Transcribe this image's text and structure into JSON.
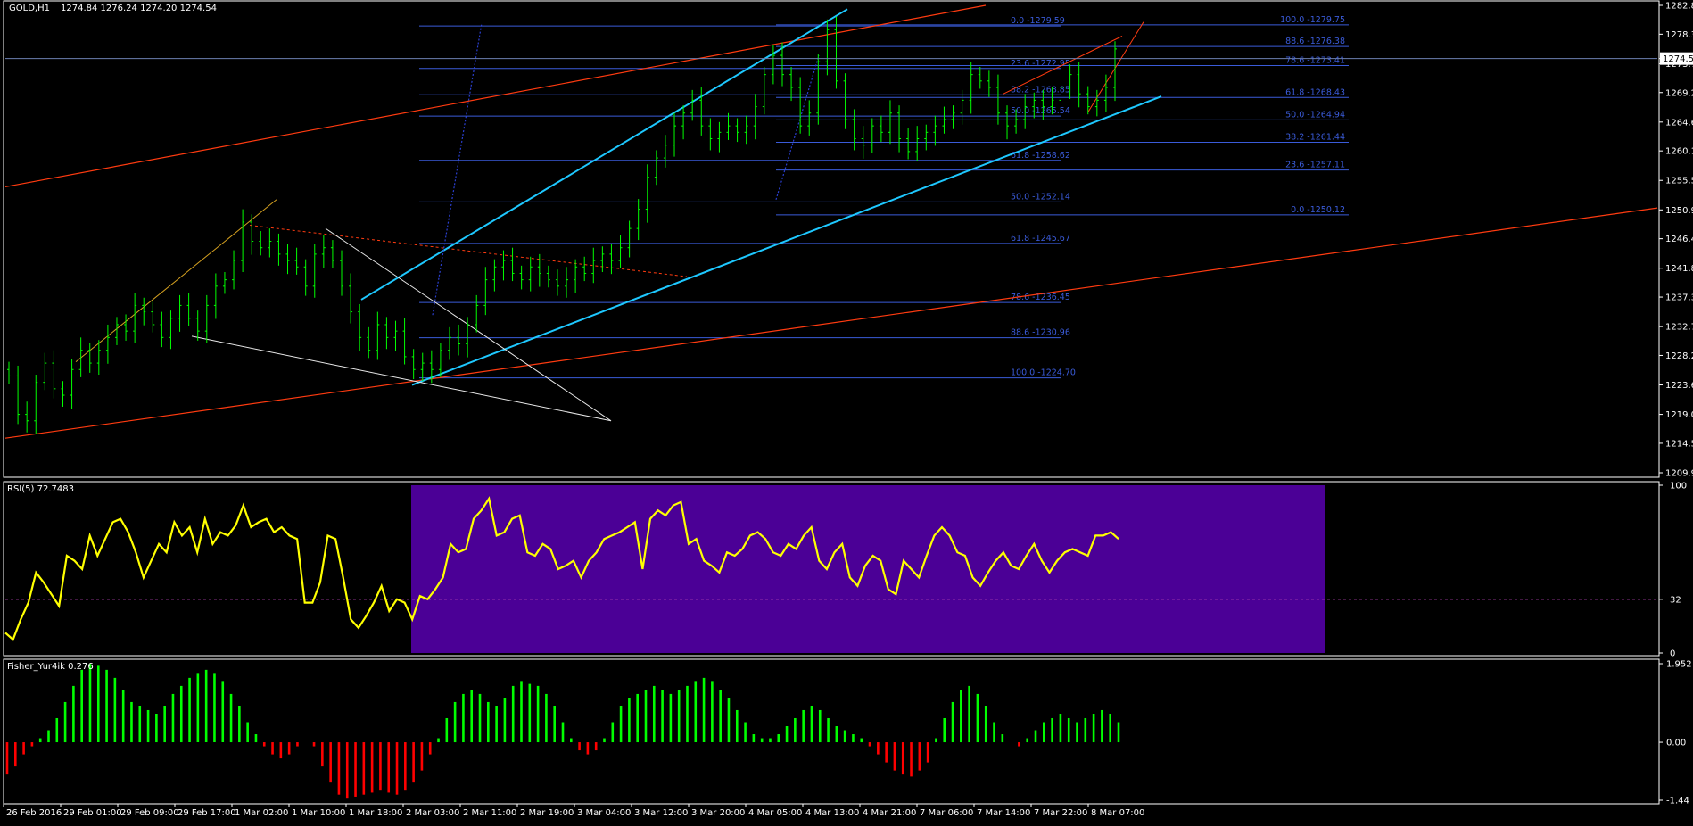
{
  "main_header": {
    "symbol": "GOLD,H1",
    "ohlc": "1274.84 1276.24 1274.20 1274.54"
  },
  "colors": {
    "background": "#000000",
    "candle": "#00ff00",
    "rsi_line": "#ffff00",
    "rsi_zone": "#4b0096",
    "fisher_positive": "#00ff00",
    "fisher_negative": "#ff0000",
    "trend_orange": "#ff3b10",
    "channel_cyan": "#1ec8ff",
    "fib_level": "#3a5bd9",
    "panel_border": "#ffffff"
  },
  "chart_data": [
    {
      "type": "candlestick",
      "title": "GOLD,H1",
      "ylim": [
        1209.9,
        1282.8
      ],
      "y_ticks": [
        "1282.8",
        "1278.3",
        "1274.5",
        "1273.7",
        "1269.2",
        "1264.6",
        "1260.1",
        "1255.5",
        "1250.9",
        "1246.4",
        "1241.8",
        "1237.3",
        "1232.7",
        "1228.2",
        "1223.6",
        "1219.0",
        "1214.5",
        "1209.9"
      ],
      "current_price": "1274.5",
      "x_ticks": [
        "26 Feb 2016",
        "29 Feb 01:00",
        "29 Feb 09:00",
        "29 Feb 17:00",
        "1 Mar 02:00",
        "1 Mar 10:00",
        "1 Mar 18:00",
        "2 Mar 03:00",
        "2 Mar 11:00",
        "2 Mar 19:00",
        "3 Mar 04:00",
        "3 Mar 12:00",
        "3 Mar 20:00",
        "4 Mar 05:00",
        "4 Mar 13:00",
        "4 Mar 21:00",
        "7 Mar 06:00",
        "7 Mar 14:00",
        "7 Mar 22:00",
        "8 Mar 07:00"
      ],
      "close_series": [
        1225,
        1219,
        1218,
        1224,
        1227,
        1223,
        1222,
        1226,
        1229,
        1227,
        1229,
        1231,
        1233,
        1232,
        1236,
        1235,
        1233,
        1231,
        1234,
        1236,
        1234,
        1232,
        1236,
        1239,
        1240,
        1243,
        1249,
        1246,
        1245,
        1246,
        1244,
        1243,
        1242,
        1239,
        1244,
        1245,
        1243,
        1239,
        1235,
        1231,
        1229,
        1233,
        1231,
        1232,
        1228,
        1226,
        1227,
        1226,
        1229,
        1231,
        1230,
        1233,
        1236,
        1240,
        1242,
        1243,
        1241,
        1240,
        1242,
        1241,
        1240,
        1239,
        1240,
        1242,
        1241,
        1243,
        1244,
        1243,
        1245,
        1248,
        1251,
        1256,
        1259,
        1261,
        1264,
        1266,
        1268,
        1264,
        1262,
        1263,
        1264,
        1263,
        1264,
        1267,
        1272,
        1275,
        1272,
        1270,
        1264,
        1266,
        1274,
        1279,
        1271,
        1265,
        1262,
        1261,
        1264,
        1263,
        1266,
        1262,
        1260,
        1262,
        1263,
        1264,
        1265,
        1266,
        1268,
        1272,
        1271,
        1270,
        1266,
        1264,
        1265,
        1267,
        1268,
        1267,
        1268,
        1270,
        1272,
        1269,
        1267,
        1268,
        1270,
        1276
      ],
      "annotations": {
        "fib_right": [
          {
            "text": "100.0 -1279.75",
            "price": 1279.75
          },
          {
            "text": "88.6 -1276.38",
            "price": 1276.38
          },
          {
            "text": "78.6 -1273.41",
            "price": 1273.41
          },
          {
            "text": "61.8 -1268.43",
            "price": 1268.43
          },
          {
            "text": "50.0 -1264.94",
            "price": 1264.94
          },
          {
            "text": "38.2 -1261.44",
            "price": 1261.44
          },
          {
            "text": "23.6 -1257.11",
            "price": 1257.11
          },
          {
            "text": "0.0 -1250.12",
            "price": 1250.12
          }
        ],
        "fib_left": [
          {
            "text": "0.0 -1279.59",
            "price": 1279.59
          },
          {
            "text": "23.6 -1272.95",
            "price": 1272.95
          },
          {
            "text": "38.2 -1268.85",
            "price": 1268.85
          },
          {
            "text": "50.0 -1265.54",
            "price": 1265.54
          },
          {
            "text": "61.8 -1258.62",
            "price": 1258.62
          },
          {
            "text": "50.0 -1252.14",
            "price": 1252.14
          },
          {
            "text": "61.8 -1245.67",
            "price": 1245.67
          },
          {
            "text": "78.6 -1236.45",
            "price": 1236.45
          },
          {
            "text": "88.6 -1230.96",
            "price": 1230.96
          },
          {
            "text": "100.0 -1224.70",
            "price": 1224.7
          }
        ]
      }
    },
    {
      "type": "line",
      "title": "RSI(5) 72.7483",
      "ylim": [
        0,
        100
      ],
      "y_ticks": [
        "100",
        "32",
        "0"
      ],
      "level": 32,
      "values": [
        12,
        8,
        20,
        30,
        48,
        42,
        35,
        28,
        58,
        55,
        50,
        70,
        58,
        68,
        78,
        80,
        72,
        60,
        45,
        55,
        65,
        60,
        78,
        70,
        75,
        60,
        80,
        65,
        72,
        70,
        76,
        88,
        75,
        78,
        80,
        72,
        75,
        70,
        68,
        30,
        30,
        42,
        70,
        68,
        45,
        20,
        15,
        22,
        30,
        40,
        25,
        32,
        30,
        20,
        34,
        32,
        38,
        45,
        65,
        60,
        62,
        80,
        85,
        92,
        70,
        72,
        80,
        82,
        60,
        58,
        65,
        62,
        50,
        52,
        55,
        45,
        55,
        60,
        68,
        70,
        72,
        75,
        78,
        50,
        80,
        85,
        82,
        88,
        90,
        65,
        68,
        55,
        52,
        48,
        60,
        58,
        62,
        70,
        72,
        68,
        60,
        58,
        65,
        62,
        70,
        75,
        55,
        50,
        60,
        65,
        45,
        40,
        52,
        58,
        55,
        38,
        35,
        55,
        50,
        45,
        58,
        70,
        75,
        70,
        60,
        58,
        45,
        40,
        48,
        55,
        60,
        52,
        50,
        58,
        65,
        55,
        48,
        55,
        60,
        62,
        60,
        58,
        70,
        70,
        72,
        68
      ]
    },
    {
      "type": "bar",
      "title": "Fisher_Yur4ik 0.276",
      "ylim": [
        -1.44,
        1.952
      ],
      "y_ticks": [
        "1.952",
        "0.00",
        "-1.44"
      ],
      "values": [
        -0.8,
        -0.6,
        -0.3,
        -0.1,
        0.1,
        0.3,
        0.6,
        1.0,
        1.4,
        1.8,
        1.95,
        1.9,
        1.8,
        1.6,
        1.3,
        1.0,
        0.9,
        0.8,
        0.7,
        0.9,
        1.2,
        1.4,
        1.6,
        1.7,
        1.8,
        1.7,
        1.5,
        1.2,
        0.9,
        0.5,
        0.2,
        -0.1,
        -0.3,
        -0.4,
        -0.3,
        -0.1,
        0.0,
        -0.1,
        -0.6,
        -1.0,
        -1.3,
        -1.4,
        -1.35,
        -1.3,
        -1.25,
        -1.2,
        -1.25,
        -1.3,
        -1.2,
        -1.0,
        -0.7,
        -0.3,
        0.1,
        0.6,
        1.0,
        1.2,
        1.3,
        1.2,
        1.0,
        0.9,
        1.1,
        1.4,
        1.5,
        1.45,
        1.4,
        1.2,
        0.9,
        0.5,
        0.1,
        -0.2,
        -0.3,
        -0.2,
        0.1,
        0.5,
        0.9,
        1.1,
        1.2,
        1.3,
        1.4,
        1.3,
        1.2,
        1.3,
        1.4,
        1.5,
        1.6,
        1.5,
        1.3,
        1.1,
        0.8,
        0.5,
        0.2,
        0.1,
        0.1,
        0.2,
        0.4,
        0.6,
        0.8,
        0.9,
        0.8,
        0.6,
        0.4,
        0.3,
        0.2,
        0.1,
        -0.1,
        -0.3,
        -0.5,
        -0.7,
        -0.8,
        -0.85,
        -0.7,
        -0.5,
        0.1,
        0.6,
        1.0,
        1.3,
        1.4,
        1.2,
        0.9,
        0.5,
        0.2,
        0.0,
        -0.1,
        0.1,
        0.3,
        0.5,
        0.6,
        0.7,
        0.6,
        0.5,
        0.6,
        0.7,
        0.8,
        0.7,
        0.5
      ]
    }
  ]
}
